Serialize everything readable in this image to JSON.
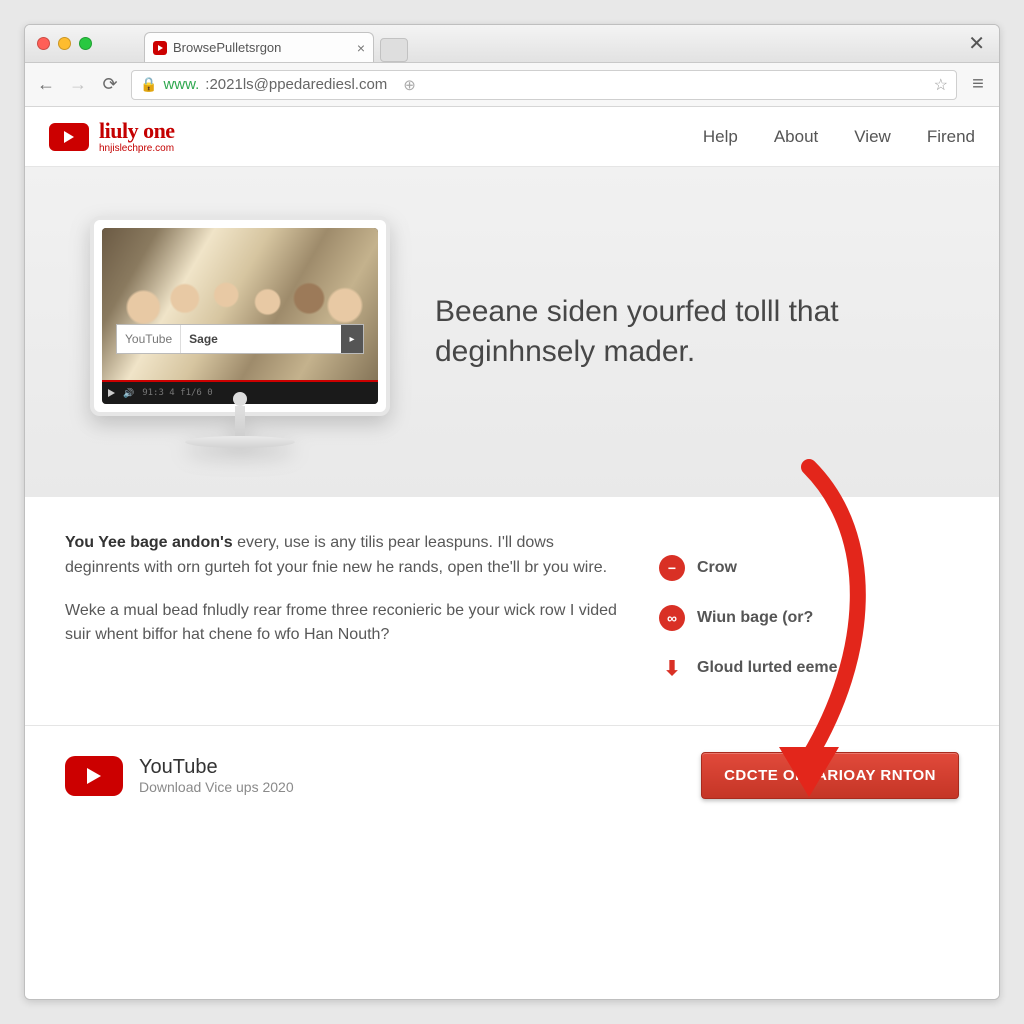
{
  "browser": {
    "tab_title": "BrowsePulletsrgon",
    "url_secure_prefix": "www.",
    "url_rest": ":2021ls@ppedarediesl.com"
  },
  "site": {
    "brand_title": "liuly one",
    "brand_sub": "hnjislechpre.com",
    "nav": {
      "help": "Help",
      "about": "About",
      "view": "View",
      "firend": "Firend"
    }
  },
  "hero": {
    "search_label": "YouTube",
    "search_value": "Sage",
    "headline": "Beeane siden yourfed tolll that deginhnsely mader.",
    "player_time": "91:3 4 f1/6 0"
  },
  "content": {
    "p1_bold": "You Yee bage andon's",
    "p1_rest": " every, use is any tilis pear leaspuns. I'll dows deginrents with orn gurteh fot your fnie new he rands, open the'll br you wire.",
    "p2": "Weke a mual bead fnludly rear frome three reconieric be your wick row I vided suir whent biffor hat chene fo wfo Han Nouth?",
    "features": {
      "f1": "Crow",
      "f2": "Wiun bage (or?",
      "f3": "Gloud lurted eeme"
    }
  },
  "footer": {
    "title": "YouTube",
    "subtitle": "Download Vice ups 2020",
    "cta": "CDCTE ONLARIOAY RNTON"
  }
}
